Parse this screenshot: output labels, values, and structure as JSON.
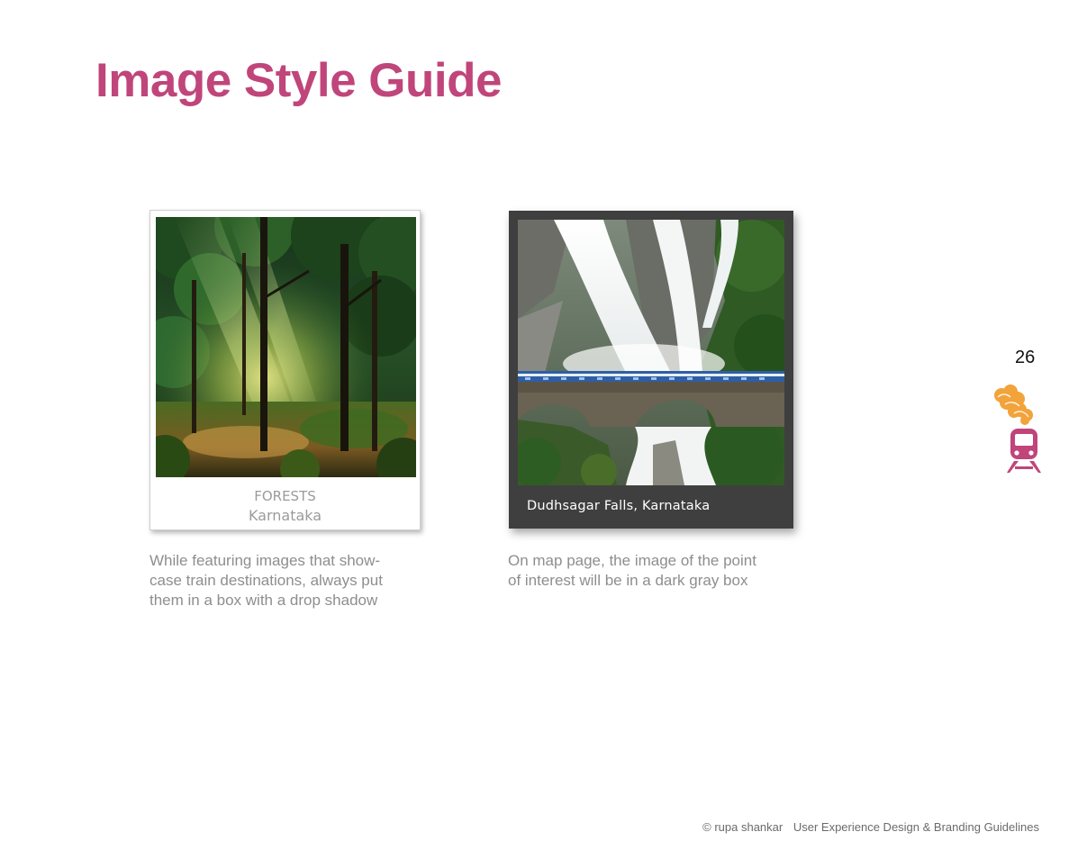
{
  "title": "Image Style Guide",
  "page_number": "26",
  "cards": [
    {
      "style": "light",
      "caption_line1": "FORESTS",
      "caption_line2": "Karnataka",
      "description_lines": [
        "While featuring images that show-",
        "case train destinations, always put",
        "them in a box with a drop shadow"
      ]
    },
    {
      "style": "dark",
      "caption": "Dudhsagar Falls, Karnataka",
      "description_lines": [
        "On map page, the image of the point",
        "of interest will be in a dark gray box"
      ]
    }
  ],
  "icons": {
    "steam": "steam-cloud-icon",
    "train": "train-icon"
  },
  "colors": {
    "title": "#c0457a",
    "steam": "#f2a33a",
    "train": "#c0457a",
    "dark_box": "#3f3f3f",
    "muted_text": "#8e8e8e"
  },
  "footer": {
    "credit": "© rupa shankar",
    "title": "User Experience Design & Branding Guidelines"
  }
}
